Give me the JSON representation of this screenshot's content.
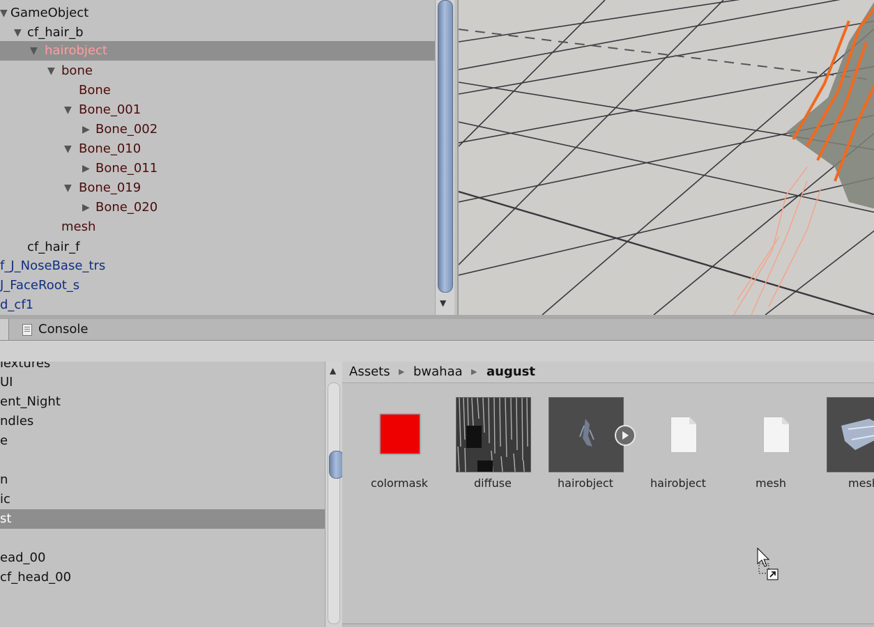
{
  "hierarchy": {
    "rows": [
      {
        "label": "GameObject",
        "color": "black"
      },
      {
        "label": "cf_hair_b",
        "color": "black"
      },
      {
        "label": "hairobject",
        "color": "selected"
      },
      {
        "label": "bone",
        "color": "prefab"
      },
      {
        "label": "Bone",
        "color": "prefab"
      },
      {
        "label": "Bone_001",
        "color": "prefab"
      },
      {
        "label": "Bone_002",
        "color": "prefab"
      },
      {
        "label": "Bone_010",
        "color": "prefab"
      },
      {
        "label": "Bone_011",
        "color": "prefab"
      },
      {
        "label": "Bone_019",
        "color": "prefab"
      },
      {
        "label": "Bone_020",
        "color": "prefab"
      },
      {
        "label": "mesh",
        "color": "prefab"
      },
      {
        "label": "cf_hair_f",
        "color": "black"
      },
      {
        "label": "f_J_NoseBase_trs",
        "color": "blue"
      },
      {
        "label": "J_FaceRoot_s",
        "color": "blue"
      },
      {
        "label": "d_cf1",
        "color": "blue"
      }
    ],
    "colors": {
      "black": "#111111",
      "prefab": "#4a0d0d",
      "selected": "#ff9e9e",
      "blue": "#0f2f86"
    }
  },
  "tabs": {
    "console_label": "Console"
  },
  "folders": {
    "rows": [
      "Textures",
      "UI",
      "ent_Night",
      "ndles",
      "e",
      "",
      "n",
      "ic",
      "st",
      "",
      "ead_00",
      "cf_head_00"
    ],
    "selected_index": 8
  },
  "breadcrumb": [
    "Assets",
    "bwahaa",
    "august"
  ],
  "assets": [
    {
      "label": "colormask",
      "kind": "red-swatch",
      "color": "#ee0000"
    },
    {
      "label": "diffuse",
      "kind": "hair-texture"
    },
    {
      "label": "hairobject",
      "kind": "model-preview"
    },
    {
      "label": "hairobject",
      "kind": "document"
    },
    {
      "label": "mesh",
      "kind": "document"
    },
    {
      "label": "mesh",
      "kind": "mesh-preview"
    }
  ],
  "icons": {
    "expand": "triangle-down-icon",
    "collapse": "triangle-right-icon",
    "console": "console-icon",
    "play": "play-icon",
    "cursor": "drag-copy-cursor-icon"
  }
}
